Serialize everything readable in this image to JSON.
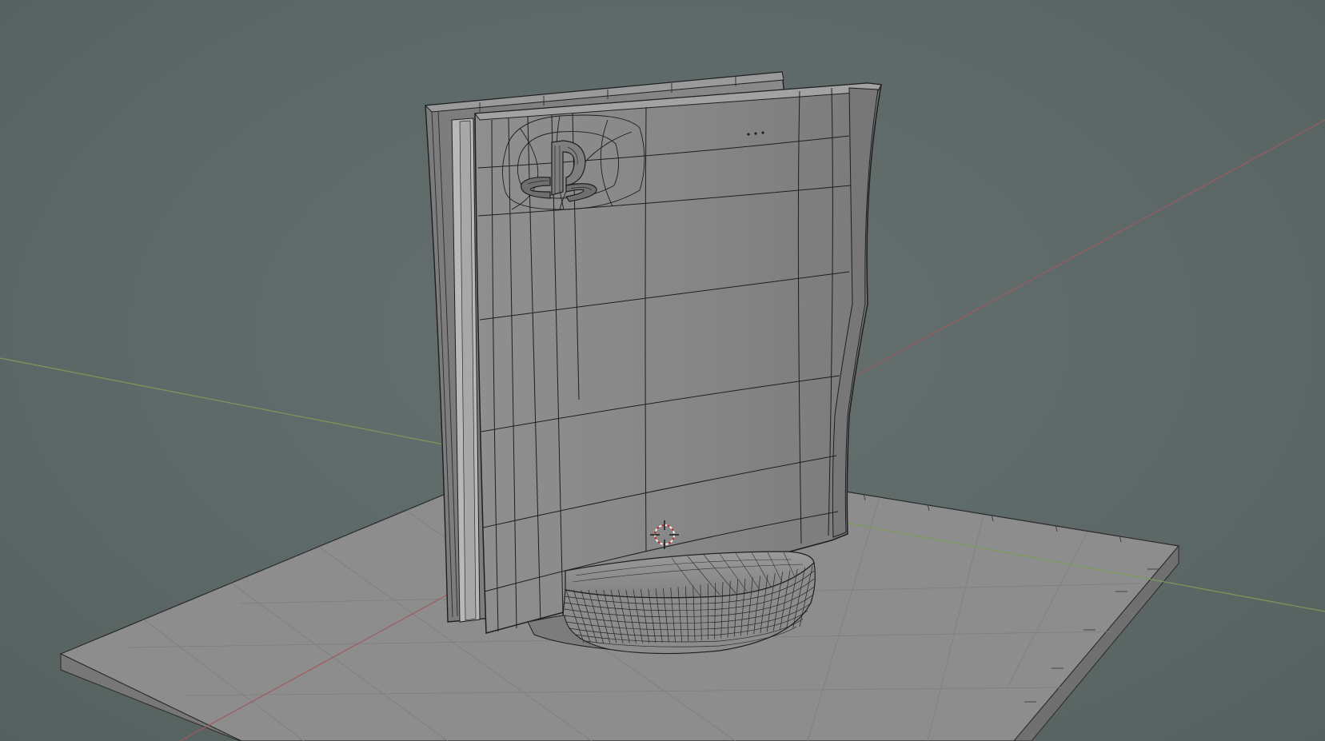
{
  "viewport": {
    "background": "#5e6a69",
    "axis_x_color": "#a05a5e",
    "axis_y_color": "#7a9a5a",
    "wire_color": "#1e1e1e",
    "surface_color": "#8e8e8e",
    "ground_color": "#8a8a8a"
  },
  "scene": {
    "objects": [
      {
        "name": "ground-plane",
        "kind": "plane"
      },
      {
        "name": "console-body",
        "kind": "mesh"
      },
      {
        "name": "console-stand",
        "kind": "mesh"
      },
      {
        "name": "playstation-logo",
        "kind": "mesh"
      }
    ],
    "cursor_icon": "3d-cursor-icon"
  }
}
